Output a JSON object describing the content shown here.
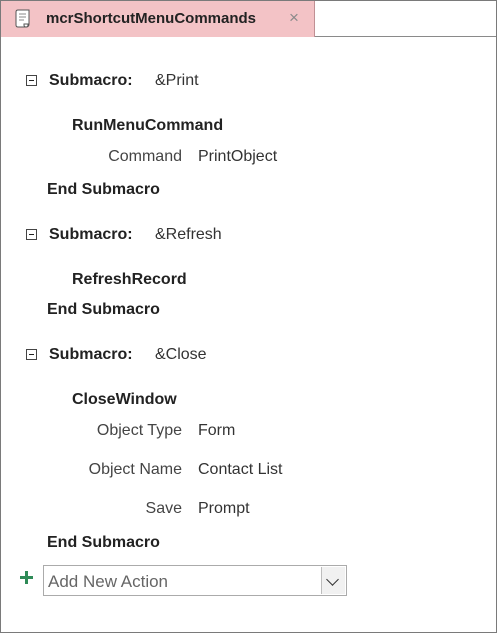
{
  "tab": {
    "title": "mcrShortcutMenuCommands",
    "close_glyph": "×",
    "icon": "macro-scroll-icon"
  },
  "keywords": {
    "submacro": "Submacro:",
    "end_submacro": "End Submacro"
  },
  "submacros": [
    {
      "name": "&Print",
      "action": "RunMenuCommand",
      "arguments": [
        {
          "label": "Command",
          "value": "PrintObject"
        }
      ]
    },
    {
      "name": "&Refresh",
      "action": "RefreshRecord",
      "arguments": []
    },
    {
      "name": "&Close",
      "action": "CloseWindow",
      "arguments": [
        {
          "label": "Object Type",
          "value": "Form"
        },
        {
          "label": "Object Name",
          "value": "Contact List"
        },
        {
          "label": "Save",
          "value": "Prompt"
        }
      ]
    }
  ],
  "add_action": {
    "value": "Add New Action",
    "icon": "plus-icon",
    "dropdown_icon": "chevron-down-icon"
  },
  "colors": {
    "tab_active": "#f3c3c6",
    "plus": "#2e8b57"
  }
}
